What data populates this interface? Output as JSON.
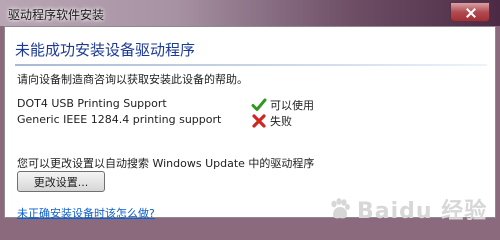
{
  "window": {
    "title": "驱动程序软件安装"
  },
  "dialog": {
    "heading": "未能成功安装设备驱动程序",
    "instruction": "请向设备制造商咨询以获取安装此设备的帮助。",
    "devices": [
      {
        "name": "DOT4 USB Printing Support",
        "status": "可以使用",
        "status_icon": "checkmark-icon",
        "status_color": "#2f9a1e"
      },
      {
        "name": "Generic IEEE 1284.4 printing support",
        "status": "失败",
        "status_icon": "red-x-icon",
        "status_color": "#d0261f"
      }
    ],
    "update_note": "您可以更改设置以自动搜索 Windows Update 中的驱动程序",
    "change_settings_button": "更改设置...",
    "help_link": "未正确安装设备时该怎么做?"
  },
  "watermark": {
    "text": "Baidu 经验"
  },
  "colors": {
    "heading": "#1c3a96",
    "link": "#0b5fd0",
    "titlebar_end": "#4c2a45"
  }
}
